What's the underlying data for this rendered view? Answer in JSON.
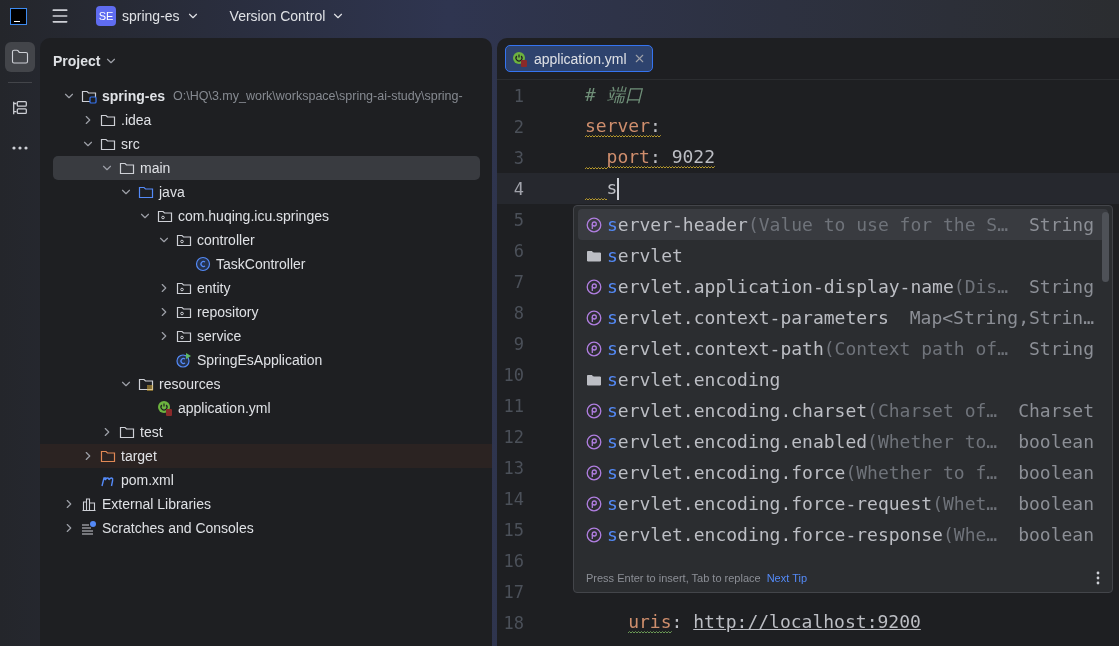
{
  "top_bar": {
    "project_badge": "SE",
    "project": "spring-es",
    "vcs": "Version Control"
  },
  "tool_strip": [
    {
      "kind": "project",
      "selected": true
    },
    {
      "kind": "structure",
      "selected": false
    },
    {
      "kind": "more",
      "selected": false
    }
  ],
  "project_panel": {
    "title": "Project",
    "tree": [
      {
        "kind": "module",
        "name": "spring-es",
        "path": "O:\\HQ\\3.my_work\\workspace\\spring-ai-study\\spring-",
        "expanded": true,
        "selected": false,
        "children": [
          {
            "kind": "folder",
            "name": ".idea",
            "expanded": false,
            "selected": false
          },
          {
            "kind": "folder",
            "name": "src",
            "expanded": true,
            "selected": false,
            "children": [
              {
                "kind": "folder",
                "name": "main",
                "expanded": true,
                "selected": true,
                "children": [
                  {
                    "kind": "source",
                    "name": "java",
                    "expanded": true,
                    "selected": false,
                    "children": [
                      {
                        "kind": "package",
                        "name": "com.huqing.icu.springes",
                        "expanded": true,
                        "selected": false,
                        "children": [
                          {
                            "kind": "package",
                            "name": "controller",
                            "expanded": true,
                            "selected": false,
                            "children": [
                              {
                                "kind": "class",
                                "name": "TaskController",
                                "selected": false
                              }
                            ]
                          },
                          {
                            "kind": "package",
                            "name": "entity",
                            "expanded": false,
                            "selected": false
                          },
                          {
                            "kind": "package",
                            "name": "repository",
                            "expanded": false,
                            "selected": false
                          },
                          {
                            "kind": "package",
                            "name": "service",
                            "expanded": false,
                            "selected": false
                          },
                          {
                            "kind": "spring-class",
                            "name": "SpringEsApplication",
                            "selected": false
                          }
                        ]
                      }
                    ]
                  },
                  {
                    "kind": "resources",
                    "name": "resources",
                    "expanded": true,
                    "selected": false,
                    "children": [
                      {
                        "kind": "yml",
                        "name": "application.yml",
                        "selected": false
                      }
                    ]
                  }
                ]
              },
              {
                "kind": "folder",
                "name": "test",
                "expanded": false,
                "selected": false
              }
            ]
          },
          {
            "kind": "excluded",
            "name": "target",
            "expanded": false,
            "selected": false
          },
          {
            "kind": "maven",
            "name": "pom.xml",
            "selected": false
          }
        ]
      },
      {
        "kind": "libraries",
        "name": "External Libraries",
        "expanded": false,
        "selected": false
      },
      {
        "kind": "scratches",
        "name": "Scratches and Consoles",
        "expanded": false,
        "selected": false
      }
    ]
  },
  "editor": {
    "tabs": [
      {
        "label": "application.yml",
        "selected": true
      }
    ],
    "lines": [
      {
        "number": "1",
        "current": false,
        "tokens": [
          {
            "kind": "comment",
            "text": "# 端口"
          }
        ]
      },
      {
        "number": "2",
        "current": false,
        "tokens": [
          {
            "kind": "key",
            "text": "server",
            "warning": true
          },
          {
            "kind": "plain",
            "text": ":",
            "warning": true
          }
        ]
      },
      {
        "number": "3",
        "current": false,
        "tokens": [
          {
            "kind": "indent",
            "warning": true
          },
          {
            "kind": "key",
            "text": "port",
            "warning": true
          },
          {
            "kind": "plain",
            "text": ": 9022",
            "warning": true
          }
        ]
      },
      {
        "number": "4",
        "current": true,
        "caret": true,
        "tokens": [
          {
            "kind": "indent",
            "warning": true
          },
          {
            "kind": "plain",
            "text": "s"
          }
        ]
      },
      {
        "number": "5",
        "current": false
      },
      {
        "number": "6",
        "current": false
      },
      {
        "number": "7",
        "current": false
      },
      {
        "number": "8",
        "current": false
      },
      {
        "number": "9",
        "current": false
      },
      {
        "number": "10",
        "current": false
      },
      {
        "number": "11",
        "current": false
      },
      {
        "number": "12",
        "current": false
      },
      {
        "number": "13",
        "current": false
      },
      {
        "number": "14",
        "current": false
      },
      {
        "number": "15",
        "current": false
      },
      {
        "number": "16",
        "current": false
      },
      {
        "number": "17",
        "current": false
      },
      {
        "number": "18",
        "current": false,
        "tokens": [
          {
            "kind": "indent"
          },
          {
            "kind": "indent"
          },
          {
            "kind": "key",
            "text": "uris",
            "typo": true
          },
          {
            "kind": "plain",
            "text": ": "
          },
          {
            "kind": "url",
            "text": "http://localhost:9200"
          }
        ]
      }
    ]
  },
  "completion": {
    "items": [
      {
        "kind": "property",
        "name": "server-header",
        "hint": "(Value to use for the S…",
        "type": "String",
        "selected": true
      },
      {
        "kind": "group",
        "name": "servlet",
        "selected": false
      },
      {
        "kind": "property",
        "name": "servlet.application-display-name",
        "hint": "(Dis…",
        "type": "String",
        "selected": false
      },
      {
        "kind": "property",
        "name": "servlet.context-parameters",
        "type": "Map<String,Strin…",
        "selected": false
      },
      {
        "kind": "property",
        "name": "servlet.context-path",
        "hint": "(Context path of…",
        "type": "String",
        "selected": false
      },
      {
        "kind": "group",
        "name": "servlet.encoding",
        "selected": false
      },
      {
        "kind": "property",
        "name": "servlet.encoding.charset",
        "hint": "(Charset of…",
        "type": "Charset",
        "selected": false
      },
      {
        "kind": "property",
        "name": "servlet.encoding.enabled",
        "hint": "(Whether to…",
        "type": "boolean",
        "selected": false
      },
      {
        "kind": "property",
        "name": "servlet.encoding.force",
        "hint": "(Whether to f…",
        "type": "boolean",
        "selected": false
      },
      {
        "kind": "property",
        "name": "servlet.encoding.force-request",
        "hint": "(Whet…",
        "type": "boolean",
        "selected": false
      },
      {
        "kind": "property",
        "name": "servlet.encoding.force-response",
        "hint": "(Whe…",
        "type": "boolean",
        "selected": false
      }
    ],
    "footer": {
      "hint": "Press Enter to insert, Tab to replace",
      "link": "Next Tip"
    }
  }
}
